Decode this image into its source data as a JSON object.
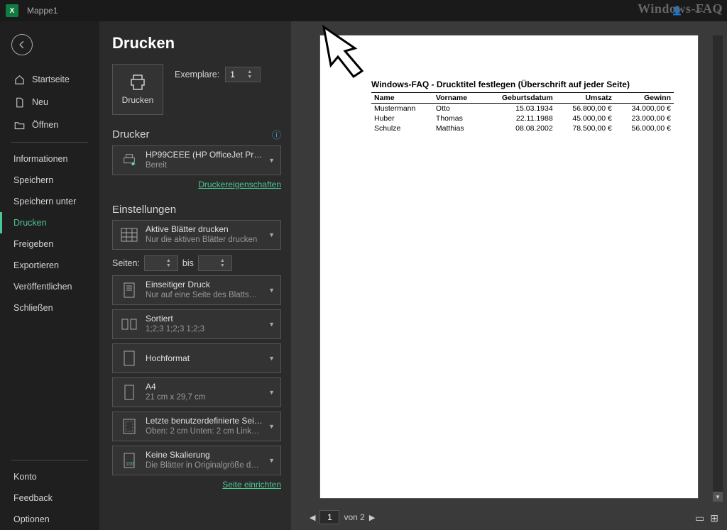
{
  "titlebar": {
    "doc": "Mappe1",
    "app_icon_label": "X"
  },
  "watermark": "Windows-FAQ",
  "sidebar": {
    "home": "Startseite",
    "new": "Neu",
    "open": "Öffnen",
    "items": [
      "Informationen",
      "Speichern",
      "Speichern unter",
      "Drucken",
      "Freigeben",
      "Exportieren",
      "Veröffentlichen",
      "Schließen"
    ],
    "active_index": 3,
    "bottom": [
      "Konto",
      "Feedback",
      "Optionen"
    ]
  },
  "panel": {
    "title": "Drucken",
    "print_btn": "Drucken",
    "copies_label": "Exemplare:",
    "copies_value": "1",
    "printer_heading": "Drucker",
    "printer": {
      "name": "HP99CEEE (HP OfficeJet Pro…",
      "status": "Bereit"
    },
    "printer_props": "Druckereigenschaften",
    "settings_heading": "Einstellungen",
    "opt_sheets": {
      "t1": "Aktive Blätter drucken",
      "t2": "Nur die aktiven Blätter drucken"
    },
    "pages_label": "Seiten:",
    "pages_to": "bis",
    "opt_duplex": {
      "t1": "Einseitiger Druck",
      "t2": "Nur auf eine Seite des Blatts…"
    },
    "opt_collate": {
      "t1": "Sortiert",
      "t2": "1;2;3    1;2;3    1;2;3"
    },
    "opt_orient": {
      "t1": "Hochformat",
      "t2": ""
    },
    "opt_paper": {
      "t1": "A4",
      "t2": "21 cm x 29,7 cm"
    },
    "opt_margins": {
      "t1": "Letzte benutzerdefinierte Seit…",
      "t2": "Oben: 2 cm Unten: 2 cm Link…"
    },
    "opt_scale": {
      "t1": "Keine Skalierung",
      "t2": "Die Blätter in Originalgröße d…"
    },
    "page_setup": "Seite einrichten"
  },
  "preview": {
    "nav": {
      "of": "von 2",
      "current": "1"
    },
    "doc_title": "Windows-FAQ - Drucktitel festlegen (Überschrift auf jeder Seite)",
    "headers": [
      "Name",
      "Vorname",
      "Geburtsdatum",
      "Umsatz",
      "Gewinn"
    ],
    "rows": [
      [
        "Mustermann",
        "Otto",
        "15.03.1934",
        "56.800,00 €",
        "34.000,00 €"
      ],
      [
        "Huber",
        "Thomas",
        "22.11.1988",
        "45.000,00 €",
        "23.000,00 €"
      ],
      [
        "Schulze",
        "Matthias",
        "08.08.2002",
        "78.500,00 €",
        "56.000,00 €"
      ]
    ]
  }
}
